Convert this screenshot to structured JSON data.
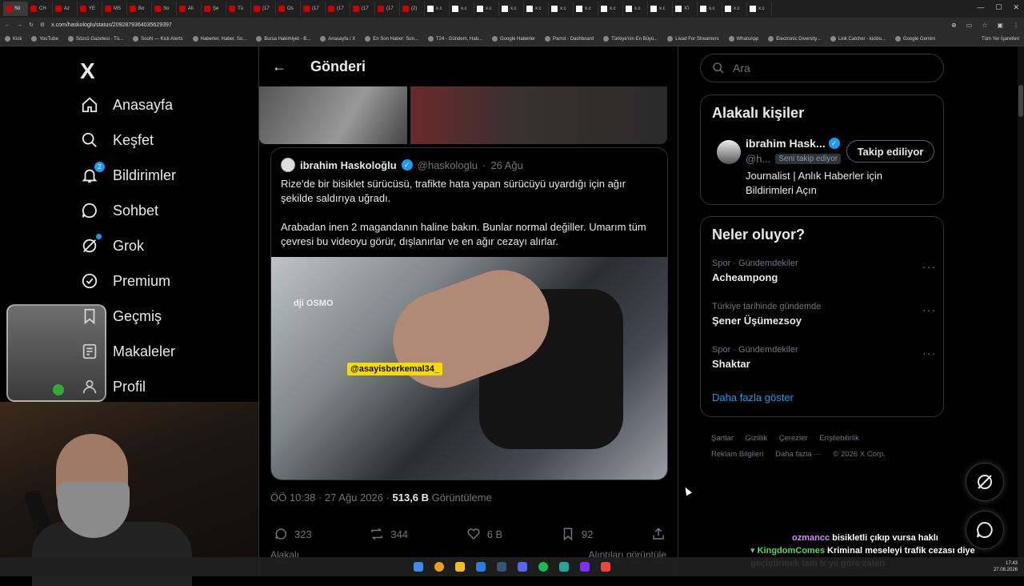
{
  "browser": {
    "tabs": [
      {
        "label": "Sö",
        "type": "y"
      },
      {
        "label": "CH",
        "type": "y"
      },
      {
        "label": "Az",
        "type": "y"
      },
      {
        "label": "YE",
        "type": "y"
      },
      {
        "label": "MS",
        "type": "y"
      },
      {
        "label": "Bo",
        "type": "y"
      },
      {
        "label": "So",
        "type": "y"
      },
      {
        "label": "Ali",
        "type": "y"
      },
      {
        "label": "Şe",
        "type": "y"
      },
      {
        "label": "Tü",
        "type": "y"
      },
      {
        "label": "(17",
        "type": "y"
      },
      {
        "label": "Os",
        "type": "y"
      },
      {
        "label": "(17",
        "type": "y"
      },
      {
        "label": "(17",
        "type": "y"
      },
      {
        "label": "(17",
        "type": "y"
      },
      {
        "label": "(17",
        "type": "y"
      },
      {
        "label": "(2)",
        "type": "y"
      },
      {
        "label": "x.c",
        "type": "x"
      },
      {
        "label": "x.c",
        "type": "x"
      },
      {
        "label": "x.c",
        "type": "x"
      },
      {
        "label": "x.c",
        "type": "x"
      },
      {
        "label": "x.c",
        "type": "x"
      },
      {
        "label": "x.c",
        "type": "x"
      },
      {
        "label": "x.c",
        "type": "x"
      },
      {
        "label": "x.c",
        "type": "x"
      },
      {
        "label": "x.c",
        "type": "x"
      },
      {
        "label": "x.c",
        "type": "x"
      },
      {
        "label": "X'i",
        "type": "x"
      },
      {
        "label": "x.c",
        "type": "x"
      },
      {
        "label": "x.c",
        "type": "x"
      },
      {
        "label": "x.c",
        "type": "x"
      }
    ],
    "url": "x.com/haskologlu/status/2092879364035629397",
    "bookmarks": [
      "Kick",
      "YouTube",
      "Sözcü Gazetesi - Tü...",
      "SooN — Kick Alerts",
      "Haberler, Haber, So...",
      "Bursa Hakimiyet - B...",
      "Anasayfa / X",
      "En Son Haber: Son...",
      "T24 - Gündem, Hab...",
      "Google Haberler",
      "Parrot - Dashboard",
      "Türkiye'nin En Büyü...",
      "Livad For Streamers",
      "WhatsApp",
      "Electronic Diversity...",
      "Link Catcher - kicklo...",
      "Google Gemini"
    ],
    "bookmarks_end": "Tüm Yer İşaretleri"
  },
  "sidebar": {
    "logo": "X",
    "items": [
      {
        "label": "Anasayfa",
        "icon": "home-icon"
      },
      {
        "label": "Keşfet",
        "icon": "search-icon"
      },
      {
        "label": "Bildirimler",
        "icon": "bell-icon",
        "badge": "2"
      },
      {
        "label": "Sohbet",
        "icon": "chat-icon"
      },
      {
        "label": "Grok",
        "icon": "grok-icon"
      },
      {
        "label": "Premium",
        "icon": "premium-icon"
      },
      {
        "label": "Geçmiş",
        "icon": "bookmark-icon"
      },
      {
        "label": "Makaleler",
        "icon": "article-icon"
      },
      {
        "label": "Profil",
        "icon": "profile-icon"
      }
    ]
  },
  "post": {
    "header_title": "Gönderi",
    "quote": {
      "name": "ibrahim Haskoloğlu",
      "handle": "@haskologlu",
      "date": "26 Ağu",
      "text1": "Rize'de bir bisiklet sürücüsü, trafikte hata yapan sürücüyü uyardığı için ağır şekilde saldırıya uğradı.",
      "text2": "Arabadan inen 2 magandanın haline bakın. Bunlar normal değiller. Umarım tüm çevresi bu videoyu görür, dışlanırlar ve en ağır cezayı alırlar.",
      "video_tag": "@asayisberkemal34_",
      "video_watermark": "dji OSMO"
    },
    "time": "ÖÖ 10:38 · 27 Ağu 2026 · ",
    "views": "513,6 B",
    "views_label": " Görüntüleme",
    "stats": {
      "replies": "323",
      "reposts": "344",
      "likes": "6 B",
      "bookmarks": "92"
    },
    "below_left": "Alakalı",
    "below_right": "Alıntıları görüntüle"
  },
  "right": {
    "search_placeholder": "Ara",
    "related_title": "Alakalı kişiler",
    "person": {
      "name": "ibrahim Hask...",
      "handle": "@h...",
      "follows_you": "Seni takip ediyor",
      "follow_button": "Takip ediliyor",
      "bio": "Journalist | Anlık Haberler için Bildirimleri Açın"
    },
    "trends_title": "Neler oluyor?",
    "trends": [
      {
        "category": "Spor · Gündemdekiler",
        "name": "Acheampong"
      },
      {
        "category": "Türkiye tarihinde gündemde",
        "name": "Şener Üşümezsoy"
      },
      {
        "category": "Spor · Gündemdekiler",
        "name": "Shaktar"
      }
    ],
    "show_more": "Daha fazla göster",
    "footer": [
      "Şartlar",
      "Gizlilik",
      "Çerezler",
      "Erişilebilirlik",
      "Reklam Bilgileri",
      "Daha fazla ···",
      "© 2026 X Corp."
    ]
  },
  "chat_overlay": {
    "line1_user": "ozmancc",
    "line1_msg": "bisikletli çıkıp vursa haklı",
    "line2_user": "KingdomComes",
    "line2_msg": "Kriminal meseleyi trafik cezası diye geçiştirmek tam tr ye göre zaten"
  },
  "taskbar": {
    "time": "17:43",
    "date": "27.08.2026"
  },
  "colors": {
    "accent": "#1d9bf0",
    "bg": "#000000",
    "text": "#e7e9ea",
    "muted": "#71767b"
  }
}
